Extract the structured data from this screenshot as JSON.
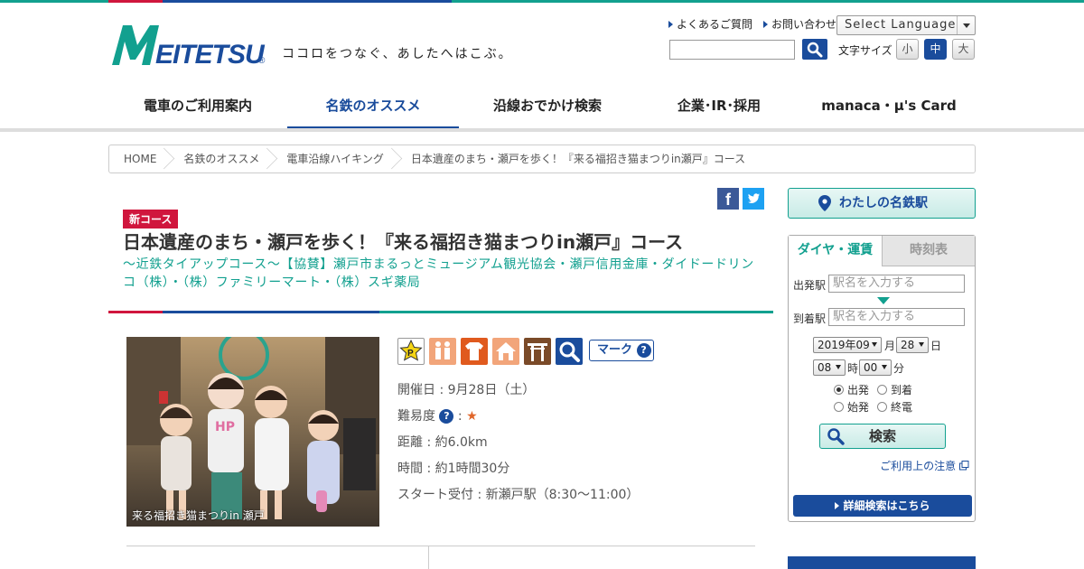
{
  "header": {
    "logo_text": "MEITETSU",
    "tagline": "ココロをつなぐ、あしたへはこぶ。",
    "links": [
      "よくあるご質問",
      "お問い合わせ"
    ],
    "language_select": "Select Language",
    "font_size_label": "文字サイズ",
    "font_sizes": [
      "小",
      "中",
      "大"
    ]
  },
  "nav": {
    "items": [
      "電車のご利用案内",
      "名鉄のオススメ",
      "沿線おでかけ検索",
      "企業･IR･採用",
      "manaca・μ's Card"
    ],
    "active_index": 1
  },
  "breadcrumb": [
    "HOME",
    "名鉄のオススメ",
    "電車沿線ハイキング",
    "日本遺産のまち・瀬戸を歩く！『来る福招き猫まつりin瀬戸』コース"
  ],
  "article": {
    "badge": "新コース",
    "title": "日本遺産のまち・瀬戸を歩く！『来る福招き猫まつりin瀬戸』コース",
    "subtitle": "～近鉄タイアップコース～【協賛】瀬戸市まるっとミュージアム観光協会・瀬戸信用金庫・ダイドードリンコ（株）・（株）ファミリーマート・（株）スギ薬局",
    "photo_caption": "来る福招き猫まつりin 瀬戸",
    "mark_button": "マーク",
    "date": "開催日 : 9月28日（土）",
    "difficulty_label": "難易度",
    "difficulty_sep": ":",
    "difficulty_stars": "★",
    "distance": "距離 : 約6.0km",
    "duration": "時間 : 約1時間30分",
    "start": "スタート受付 : 新瀬戸駅（8:30～11:00）"
  },
  "sidebar": {
    "my_station": "わたしの名鉄駅",
    "tabs": [
      "ダイヤ・運賃",
      "時刻表"
    ],
    "from_label": "出発駅",
    "from_placeholder": "駅名を入力する",
    "to_label": "到着駅",
    "to_placeholder": "駅名を入力する",
    "year_month": "2019年09",
    "month_unit": "月",
    "day": "28",
    "day_unit": "日",
    "hour": "08",
    "hour_unit": "時",
    "minute": "00",
    "minute_unit": "分",
    "radios": [
      "出発",
      "到着",
      "始発",
      "終電"
    ],
    "radio_selected": "出発",
    "search_button": "検索",
    "note_link": "ご利用上の注意",
    "detail_button": "詳細検索はこちら"
  },
  "colors": {
    "brand_blue": "#1a4c9c",
    "brand_green": "#12a08f",
    "brand_red": "#d0163d"
  }
}
